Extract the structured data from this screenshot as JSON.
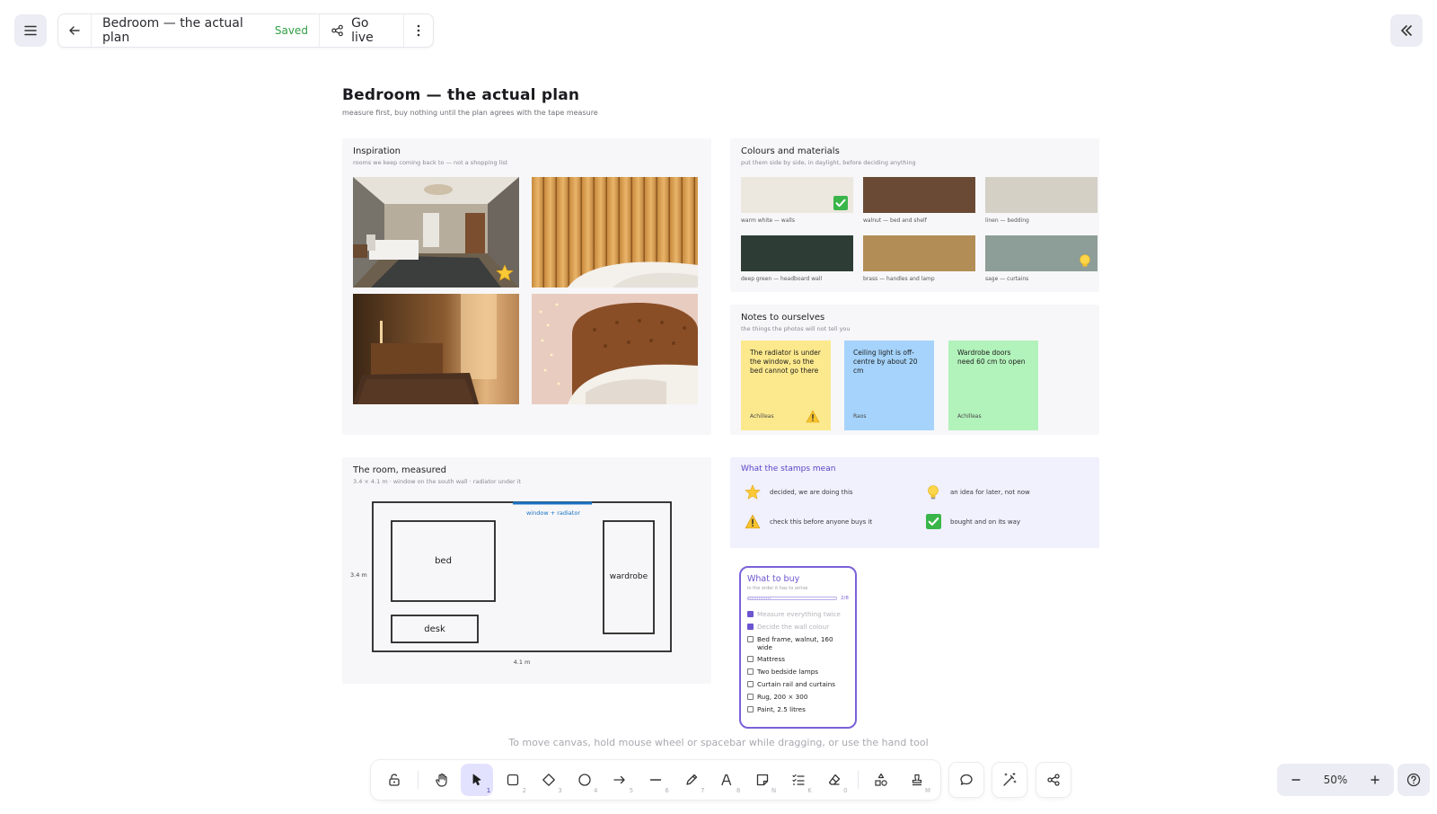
{
  "header": {
    "title": "Bedroom — the actual plan",
    "saved_label": "Saved",
    "go_live_label": "Go live"
  },
  "board": {
    "title": "Bedroom — the actual plan",
    "subtitle": "measure first, buy nothing until the plan agrees with the tape measure"
  },
  "inspiration": {
    "title": "Inspiration",
    "subtitle": "rooms we keep coming back to — not a shopping list"
  },
  "colours": {
    "title": "Colours and materials",
    "subtitle": "put them side by side, in daylight, before deciding anything",
    "swatches": [
      {
        "label": "warm white — walls",
        "color": "#ece7df"
      },
      {
        "label": "walnut — bed and shelf",
        "color": "#6a4a34"
      },
      {
        "label": "linen — bedding",
        "color": "#d4d0c6"
      },
      {
        "label": "deep green — headboard wall",
        "color": "#2d3d36"
      },
      {
        "label": "brass — handles and lamp",
        "color": "#b38d56"
      },
      {
        "label": "sage — curtains",
        "color": "#8d9d97"
      }
    ]
  },
  "notes": {
    "title": "Notes to ourselves",
    "subtitle": "the things the photos will not tell you",
    "items": [
      {
        "text": "The radiator is under the window, so the bed cannot go there",
        "author": "Achilleas",
        "color": "#fde98d"
      },
      {
        "text": "Ceiling light is off-centre by about 20 cm",
        "author": "Raos",
        "color": "#a5d3fb"
      },
      {
        "text": "Wardrobe doors need 60 cm to open",
        "author": "Achilleas",
        "color": "#b2f2bb"
      }
    ]
  },
  "room": {
    "title": "The room, measured",
    "subtitle": "3.4 × 4.1 m · window on the south wall · radiator under it",
    "window_label": "window + radiator",
    "bed_label": "bed",
    "wardrobe_label": "wardrobe",
    "desk_label": "desk",
    "height_label": "3.4 m",
    "width_label": "4.1 m"
  },
  "legend": {
    "title": "What the stamps mean",
    "items": [
      {
        "icon": "star-icon",
        "label": "decided, we are doing this"
      },
      {
        "icon": "lightbulb-icon",
        "label": "an idea for later, not now"
      },
      {
        "icon": "warning-icon",
        "label": "check this before anyone buys it"
      },
      {
        "icon": "check-icon",
        "label": "bought and on its way"
      }
    ]
  },
  "todo": {
    "title": "What to buy",
    "subtitle": "in the order it has to arrive",
    "count": "2/8",
    "progress": 0.25,
    "items": [
      {
        "label": "Measure everything twice",
        "done": true
      },
      {
        "label": "Decide the wall colour",
        "done": true
      },
      {
        "label": "Bed frame, walnut, 160 wide",
        "done": false
      },
      {
        "label": "Mattress",
        "done": false
      },
      {
        "label": "Two bedside lamps",
        "done": false
      },
      {
        "label": "Curtain rail and curtains",
        "done": false
      },
      {
        "label": "Rug, 200 × 300",
        "done": false
      },
      {
        "label": "Paint, 2.5 litres",
        "done": false
      }
    ]
  },
  "hint": "To move canvas, hold mouse wheel or spacebar while dragging, or use the hand tool",
  "toolbar": {
    "tools": [
      {
        "name": "hand",
        "key": ""
      },
      {
        "name": "selection",
        "key": "1"
      },
      {
        "name": "rectangle",
        "key": "2"
      },
      {
        "name": "diamond",
        "key": "3"
      },
      {
        "name": "ellipse",
        "key": "4"
      },
      {
        "name": "arrow",
        "key": "5"
      },
      {
        "name": "line",
        "key": "6"
      },
      {
        "name": "draw",
        "key": "7"
      },
      {
        "name": "text",
        "key": "8"
      },
      {
        "name": "sticky-note",
        "key": "N"
      },
      {
        "name": "checklist",
        "key": "K"
      },
      {
        "name": "eraser",
        "key": "0"
      },
      {
        "name": "shapes",
        "key": ""
      },
      {
        "name": "stamp",
        "key": "M"
      }
    ]
  },
  "zoom": {
    "label": "50%"
  }
}
